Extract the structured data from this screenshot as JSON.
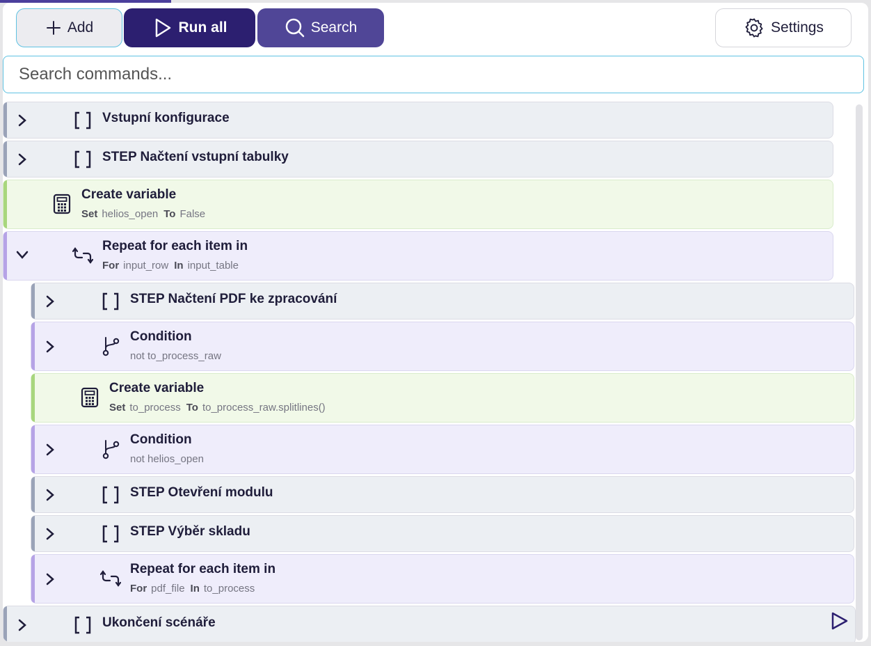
{
  "toolbar": {
    "add_label": "Add",
    "run_all_label": "Run all",
    "search_label": "Search",
    "settings_label": "Settings"
  },
  "search": {
    "placeholder": "Search commands..."
  },
  "colors": {
    "primary": "#2c1f70",
    "secondary": "#504697",
    "accent_border": "#5fc2e2"
  },
  "commands": {
    "r0": {
      "title": "Vstupní konfigurace",
      "icon": "brackets-icon"
    },
    "r1": {
      "title": "STEP Načtení vstupní tabulky",
      "icon": "brackets-icon"
    },
    "r2": {
      "title": "Create variable",
      "k1": "Set",
      "v1": "helios_open",
      "k2": "To",
      "v2": "False",
      "icon": "calculator-icon"
    },
    "r3": {
      "title": "Repeat for each item in",
      "k1": "For",
      "v1": "input_row",
      "k2": "In",
      "v2": "input_table",
      "icon": "loop-icon",
      "expanded": true
    },
    "r4": {
      "title": "STEP Načtení PDF ke zpracování",
      "icon": "brackets-icon"
    },
    "r5": {
      "title": "Condition",
      "text": "not to_process_raw",
      "icon": "branch-icon"
    },
    "r6": {
      "title": "Create variable",
      "k1": "Set",
      "v1": "to_process",
      "k2": "To",
      "v2": "to_process_raw.splitlines()",
      "icon": "calculator-icon"
    },
    "r7": {
      "title": "Condition",
      "text": "not helios_open",
      "icon": "branch-icon"
    },
    "r8": {
      "title": "STEP Otevření modulu",
      "icon": "brackets-icon"
    },
    "r9": {
      "title": "STEP Výběr skladu",
      "icon": "brackets-icon"
    },
    "r10": {
      "title": "Repeat for each item in",
      "k1": "For",
      "v1": "pdf_file",
      "k2": "In",
      "v2": "to_process",
      "icon": "loop-icon"
    },
    "r11": {
      "title": "Ukončení scénáře",
      "icon": "brackets-icon"
    }
  }
}
